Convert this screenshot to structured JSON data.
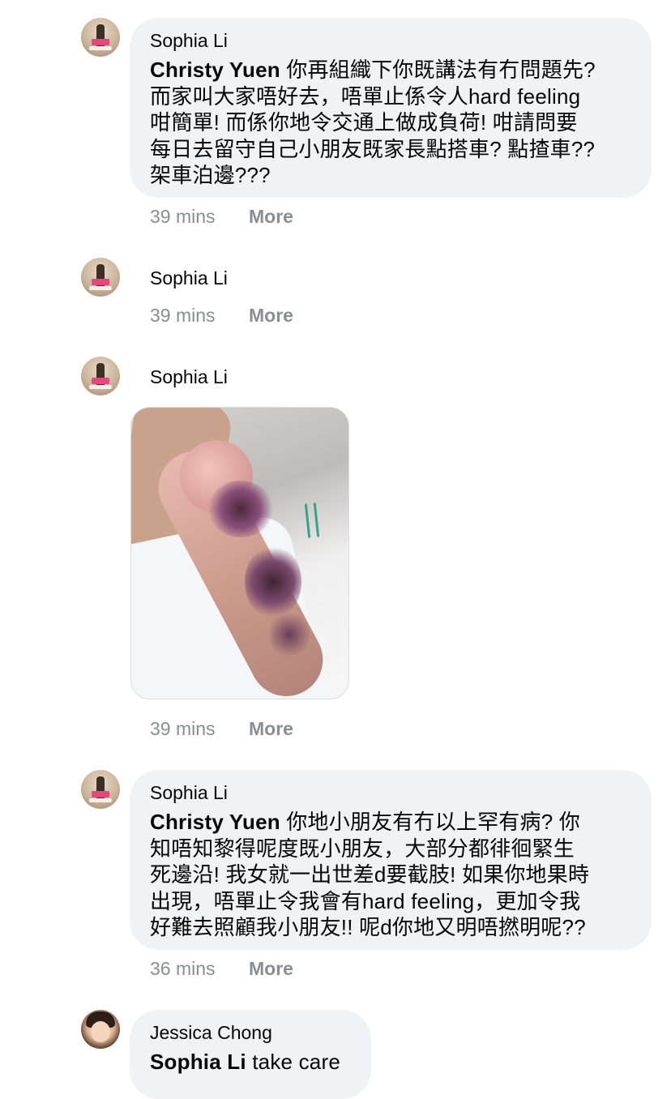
{
  "comments": [
    {
      "author": "Sophia Li",
      "mention": "Christy Yuen",
      "text": " 你再組織下你既講法有冇問題先?\n而家叫大家唔好去，唔單止係令人hard feeling\n咁簡單! 而係你地令交通上做成負荷! 咁請問要\n每日去留守自己小朋友既家長點搭車? 點揸車??\n架車泊邊???",
      "time": "39 mins",
      "more": "More"
    },
    {
      "author": "Sophia Li",
      "time": "39 mins",
      "more": "More"
    },
    {
      "author": "Sophia Li",
      "image": "bruised-infant-arm-photo",
      "time": "39 mins",
      "more": "More"
    },
    {
      "author": "Sophia Li",
      "mention": "Christy Yuen",
      "text": " 你地小朋友有冇以上罕有病? 你\n知唔知黎得呢度既小朋友，大部分都徘徊緊生\n死邊沿! 我女就一出世差d要截肢! 如果你地果時\n出現，唔單止令我會有hard feeling，更加令我\n好難去照顧我小朋友!! 呢d你地又明唔撚明呢??",
      "time": "36 mins",
      "more": "More"
    },
    {
      "author": "Jessica Chong",
      "mention": "Sophia Li",
      "text": " take care"
    }
  ],
  "colors": {
    "bubble_bg": "#f0f2f5",
    "meta_text": "#8a8d91",
    "text": "#050505"
  }
}
